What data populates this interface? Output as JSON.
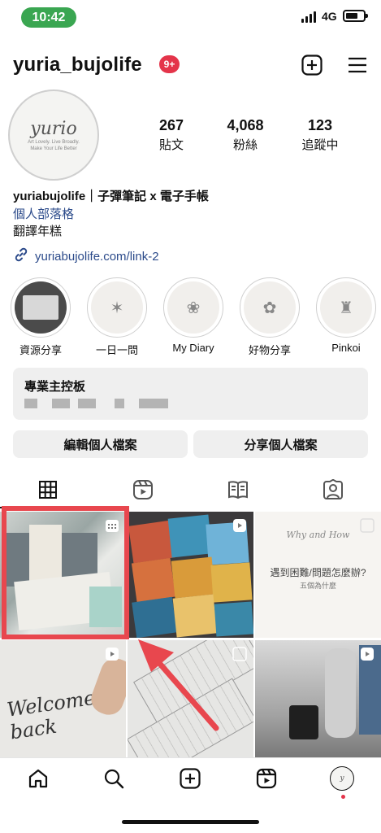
{
  "status": {
    "time": "10:42",
    "network": "4G"
  },
  "header": {
    "username": "yuria_bujolife",
    "notif_badge": "9+"
  },
  "profile": {
    "avatar_text": "yurio",
    "avatar_sub1": "Art Lovely. Live Broadly.",
    "avatar_sub2": "Make Your Life Better",
    "stats": [
      {
        "num": "267",
        "label": "貼文"
      },
      {
        "num": "4,068",
        "label": "粉絲"
      },
      {
        "num": "123",
        "label": "追蹤中"
      }
    ],
    "bio_name": "yuriabujolife｜子彈筆記 x 電子手帳",
    "bio_category": "個人部落格",
    "bio_text": "翻譯年糕",
    "bio_link": "yuriabujolife.com/link-2"
  },
  "highlights": [
    {
      "label": "資源分享"
    },
    {
      "label": "一日一問"
    },
    {
      "label": "My Diary"
    },
    {
      "label": "好物分享"
    },
    {
      "label": "Pinkoi"
    }
  ],
  "dashboard": {
    "title": "專業主控板"
  },
  "buttons": {
    "edit": "編輯個人檔案",
    "share": "分享個人檔案"
  },
  "tile3": {
    "title": "遇到困難/問題怎麼辦?",
    "sub": "五個為什麼",
    "script": "Why and How"
  },
  "tile4": {
    "script": "Welcome back"
  },
  "colors": {
    "accent_red": "#e8474e",
    "link_blue": "#2b4a8a",
    "badge_red": "#e4344a",
    "status_green": "#3aa651"
  }
}
